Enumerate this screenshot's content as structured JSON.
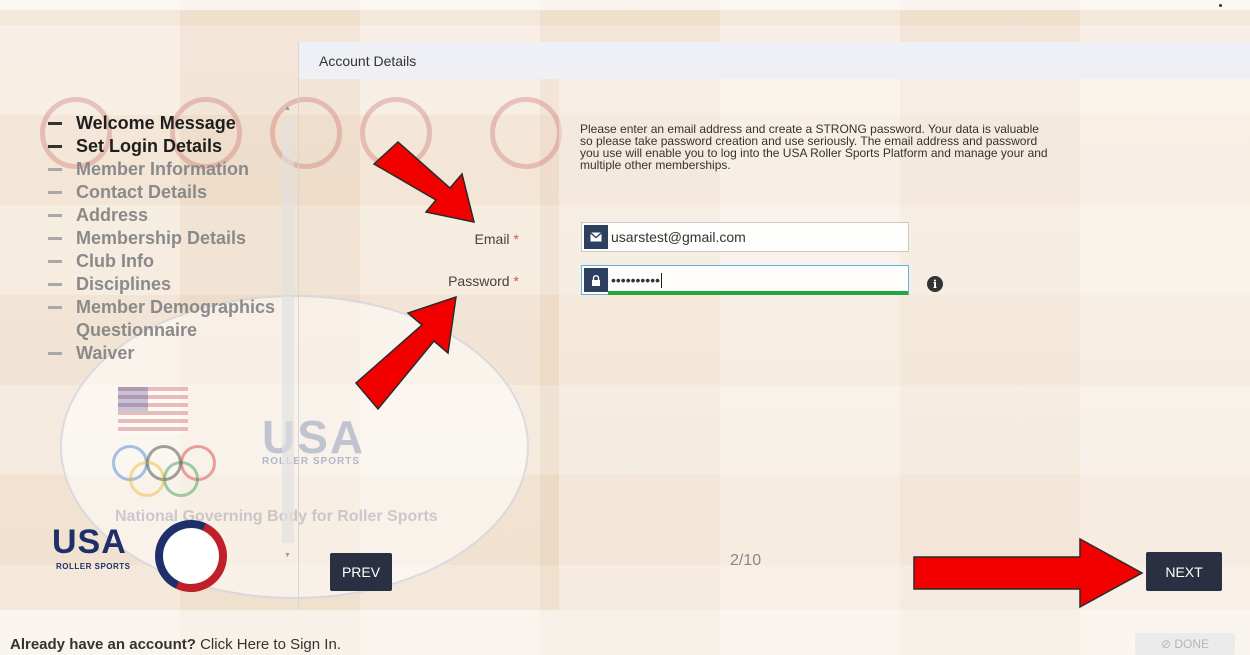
{
  "panel": {
    "title": "Account Details"
  },
  "steps": [
    {
      "label": "Welcome Message",
      "state": "done"
    },
    {
      "label": "Set Login Details",
      "state": "current"
    },
    {
      "label": "Member Information",
      "state": "pending"
    },
    {
      "label": "Contact Details",
      "state": "pending"
    },
    {
      "label": "Address",
      "state": "pending"
    },
    {
      "label": "Membership Details",
      "state": "pending"
    },
    {
      "label": "Club Info",
      "state": "pending"
    },
    {
      "label": "Disciplines",
      "state": "pending"
    },
    {
      "label": "Member Demographics Questionnaire",
      "state": "pending"
    },
    {
      "label": "Waiver",
      "state": "pending"
    }
  ],
  "intro": "Please enter an email address and create a STRONG password. Your data is valuable so please take password creation and use seriously. The email address and password you use will enable you to log into the USA Roller Sports Platform and manage your and multiple other memberships.",
  "form": {
    "email_label": "Email",
    "email_value": "usarstest@gmail.com",
    "password_label": "Password",
    "password_value": "••••••••••",
    "required_mark": "*",
    "info_glyph": "i",
    "password_strength": 1.0
  },
  "nav": {
    "prev_label": "PREV",
    "next_label": "NEXT",
    "progress": "2/10"
  },
  "footer": {
    "signin_bold": "Already have an account?",
    "signin_rest": " Click Here to Sign In.",
    "done_label": "⊘ DONE"
  },
  "logo": {
    "text": "USA",
    "sub": "ROLLER SPORTS"
  },
  "watermark": {
    "usa": "USA",
    "sub": "ROLLER SPORTS",
    "tagline": "National Governing Body for Roller Sports"
  },
  "colors": {
    "button_bg": "#2a3041",
    "arrow_red": "#f20000",
    "strength_green": "#27a43b",
    "required": "#d9534f"
  }
}
